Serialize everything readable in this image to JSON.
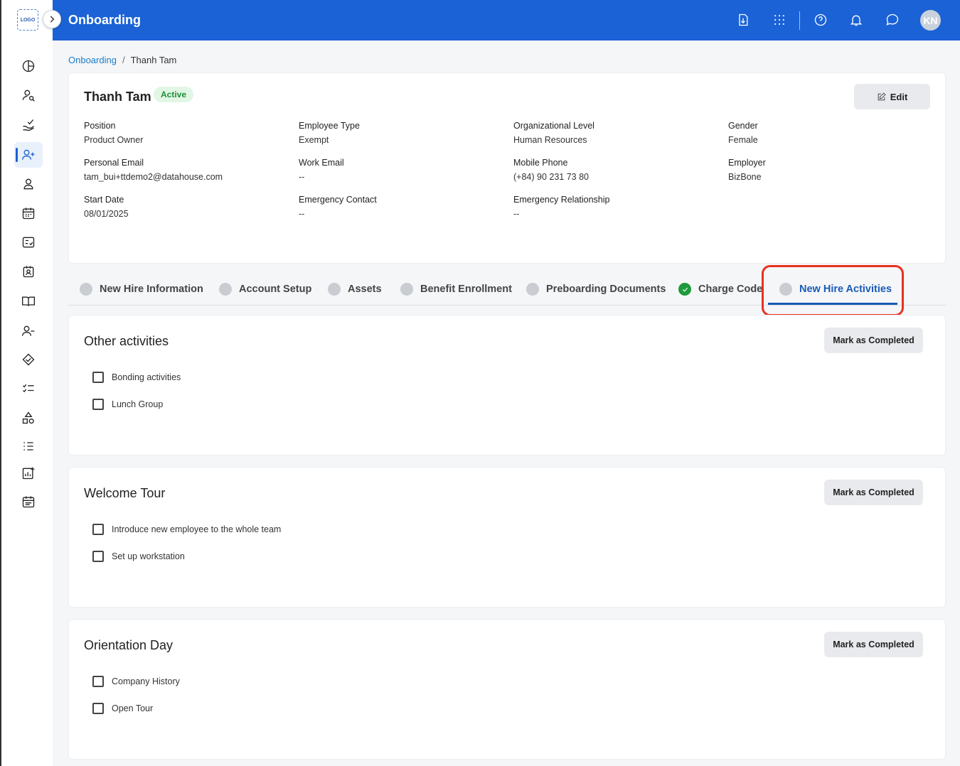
{
  "app": {
    "logo_text": "LOGO",
    "title": "Onboarding",
    "user_initials": "KN"
  },
  "breadcrumb": {
    "root": "Onboarding",
    "separator": "/",
    "current": "Thanh Tam"
  },
  "profile": {
    "name": "Thanh Tam",
    "status": "Active",
    "edit_label": "Edit",
    "fields": [
      {
        "label": "Position",
        "value": "Product Owner"
      },
      {
        "label": "Employee Type",
        "value": "Exempt"
      },
      {
        "label": "Organizational Level",
        "value": "Human Resources"
      },
      {
        "label": "Gender",
        "value": "Female"
      },
      {
        "label": "Personal Email",
        "value": "tam_bui+ttdemo2@datahouse.com"
      },
      {
        "label": "Work Email",
        "value": "--"
      },
      {
        "label": "Mobile Phone",
        "value": "(+84) 90 231 73 80"
      },
      {
        "label": "Employer",
        "value": "BizBone"
      },
      {
        "label": "Start Date",
        "value": "08/01/2025"
      },
      {
        "label": "Emergency Contact",
        "value": "--"
      },
      {
        "label": "Emergency Relationship",
        "value": "--"
      }
    ]
  },
  "tabs": [
    {
      "label": "New Hire Information",
      "state": "pending"
    },
    {
      "label": "Account Setup",
      "state": "pending"
    },
    {
      "label": "Assets",
      "state": "pending"
    },
    {
      "label": "Benefit Enrollment",
      "state": "pending"
    },
    {
      "label": "Preboarding Documents",
      "state": "pending"
    },
    {
      "label": "Charge Code",
      "state": "completed"
    },
    {
      "label": "New Hire Activities",
      "state": "pending",
      "active": true
    }
  ],
  "sections": [
    {
      "title": "Other activities",
      "button": "Mark as Completed",
      "tasks": [
        "Bonding activities",
        "Lunch Group"
      ]
    },
    {
      "title": "Welcome Tour",
      "button": "Mark as Completed",
      "tasks": [
        "Introduce new employee to the whole team",
        "Set up workstation"
      ]
    },
    {
      "title": "Orientation Day",
      "button": "Mark as Completed",
      "tasks": [
        "Company History",
        "Open Tour"
      ]
    }
  ],
  "sidebar_icons": [
    "dashboard-icon",
    "user-search-icon",
    "hand-check-icon",
    "user-add-icon",
    "person-icon",
    "calendar-icon",
    "checklist-form-icon",
    "id-badge-icon",
    "book-icon",
    "user-minus-icon",
    "handshake-icon",
    "task-list-icon",
    "shapes-icon",
    "numbered-list-icon",
    "report-icon",
    "schedule-icon"
  ],
  "colors": {
    "header": "#1a62d6",
    "accent": "#1a5bb5",
    "completed": "#1f9a3b",
    "highlight": "#e8321e",
    "badge_bg": "#e2f6e5",
    "badge_text": "#1f8f39"
  }
}
